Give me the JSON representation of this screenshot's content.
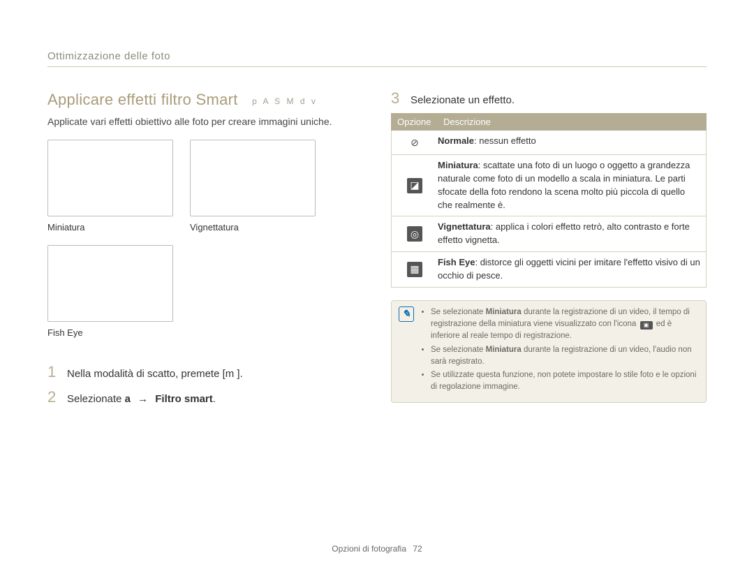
{
  "breadcrumb": "Ottimizzazione delle foto",
  "left": {
    "title": "Applicare effetti filtro Smart",
    "modes": "p A S M d v",
    "subtitle": "Applicate vari effetti obiettivo alle foto per creare immagini uniche.",
    "thumbs": {
      "miniatura": "Miniatura",
      "vignettatura": "Vignettatura",
      "fisheye": "Fish Eye"
    },
    "steps": {
      "s1_num": "1",
      "s1_text": "Nella modalità di scatto, premete [m       ].",
      "s2_num": "2",
      "s2_a": "Selezionate ",
      "s2_b": "a",
      "s2_arrow": "→",
      "s2_c": "Filtro smart",
      "s2_d": "."
    }
  },
  "right": {
    "num": "3",
    "heading": "Selezionate un effetto.",
    "table": {
      "th_option": "Opzione",
      "th_desc": "Descrizione",
      "rows": [
        {
          "icon": "⊘",
          "bold": "Normale",
          "text": ": nessun effetto"
        },
        {
          "icon": "◪",
          "bold": "Miniatura",
          "text": ": scattate una foto di un luogo o oggetto a grandezza naturale come foto di un modello a scala in miniatura. Le parti sfocate della foto rendono la scena molto più piccola di quello che realmente è."
        },
        {
          "icon": "◎",
          "bold": "Vignettatura",
          "text": ": applica i colori effetto retrò, alto contrasto e forte effetto vignetta."
        },
        {
          "icon": "▦",
          "bold": "Fish Eye",
          "text": ": distorce gli oggetti vicini per imitare l'effetto visivo di un occhio di pesce."
        }
      ]
    },
    "notes": {
      "n1a": "Se selezionate ",
      "n1b": "Miniatura",
      "n1c": " durante la registrazione di un video, il tempo di registrazione della miniatura viene visualizzato con l'icona ",
      "n1d": " ed è inferiore al reale tempo di registrazione.",
      "n2a": "Se selezionate ",
      "n2b": "Miniatura",
      "n2c": " durante la registrazione di un video, l'audio non sarà registrato.",
      "n3": "Se utilizzate questa funzione, non potete impostare lo stile foto e le opzioni di regolazione immagine."
    }
  },
  "footer": {
    "label": "Opzioni di fotografia",
    "page": "72"
  }
}
